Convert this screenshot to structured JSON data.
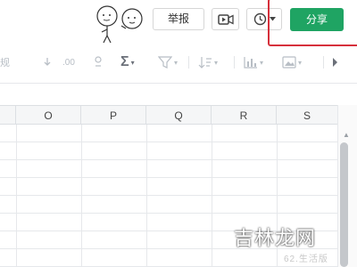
{
  "topbar": {
    "report_label": "举报",
    "share_label": "分享",
    "icons": [
      "sticker-figures-icon",
      "video-icon",
      "clock-icon",
      "dropdown-caret-icon"
    ]
  },
  "toolbar": {
    "number_format_label": "规",
    "decimal_label": ".00",
    "sigma_label": "Σ",
    "icons": [
      "decrease-decimal-icon",
      "increase-decimal-icon",
      "sum-icon",
      "filter-icon",
      "sort-icon",
      "chart-icon",
      "image-icon",
      "more-icon"
    ]
  },
  "grid": {
    "columns": [
      "O",
      "P",
      "Q",
      "R",
      "S"
    ]
  },
  "watermark": {
    "text": "吉林龙网",
    "sub": "62.生活版"
  },
  "colors": {
    "share_bg": "#1fa463",
    "highlight_border": "#d6303b"
  }
}
